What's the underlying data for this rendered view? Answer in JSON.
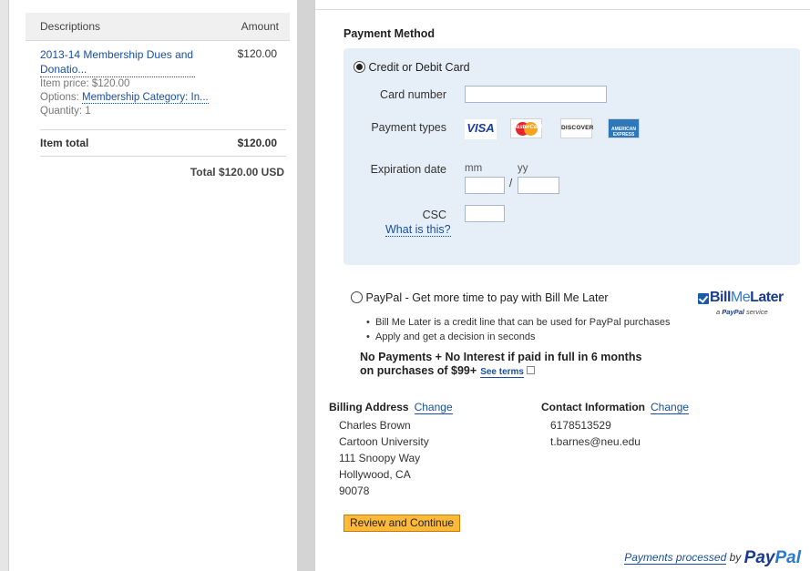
{
  "cart": {
    "col_descriptions": "Descriptions",
    "col_amount": "Amount",
    "item_name_line1": "2013-14 Membership Dues and",
    "item_name_line2": "Donatio...",
    "item_amount": "$120.00",
    "item_price_label": "Item price: $120.00",
    "options_prefix": "Options:",
    "options_link": "Membership Category: In...",
    "quantity_label": "Quantity: 1",
    "item_total_label": "Item total",
    "item_total_amount": "$120.00",
    "grand_total": "Total $120.00 USD"
  },
  "payment": {
    "title": "Payment Method",
    "card_option_label": "Credit or Debit Card",
    "card_number_label": "Card number",
    "payment_types_label": "Payment types",
    "card_types": [
      "VISA",
      "MasterCard",
      "DISCOVER",
      "AMERICAN EXPRESS"
    ],
    "expiration_label": "Expiration date",
    "mm_label": "mm",
    "yy_label": "yy",
    "slash": "/",
    "csc_label": "CSC",
    "what_is_this": "What is this?",
    "paypal_option_label": "PayPal - Get more time to pay with Bill Me Later",
    "bullets": [
      "Bill Me Later is a credit line that can be used for PayPal purchases",
      "Apply and get a decision in seconds"
    ],
    "promo_line1": "No Payments + No Interest if paid in full in 6 months",
    "promo_line2": "on purchases of $99+",
    "see_terms": "See terms",
    "bml_logo_bill": "Bill",
    "bml_logo_me": "Me",
    "bml_logo_later": "Later",
    "bml_sub_prefix": "a",
    "bml_sub_brand": "PayPal",
    "bml_sub_suffix": "service"
  },
  "billing": {
    "title": "Billing Address",
    "change": "Change",
    "lines": [
      "Charles Brown",
      "Cartoon University",
      "111 Snoopy Way",
      "Hollywood, CA",
      "90078"
    ]
  },
  "contact": {
    "title": "Contact Information",
    "change": "Change",
    "lines": [
      "6178513529",
      "t.barnes@neu.edu"
    ]
  },
  "actions": {
    "review_button": "Review and Continue"
  },
  "footer": {
    "processed_link": "Payments processed",
    "by": "by",
    "brand_pay": "Pay",
    "brand_pal": "Pal"
  },
  "colors": {
    "link": "#1a4fa0",
    "card_box_bg": "#e6eef8",
    "review_button_bg": "#fdb93a",
    "paypal_dark": "#1a3c8c",
    "paypal_light": "#2b7ad0"
  }
}
